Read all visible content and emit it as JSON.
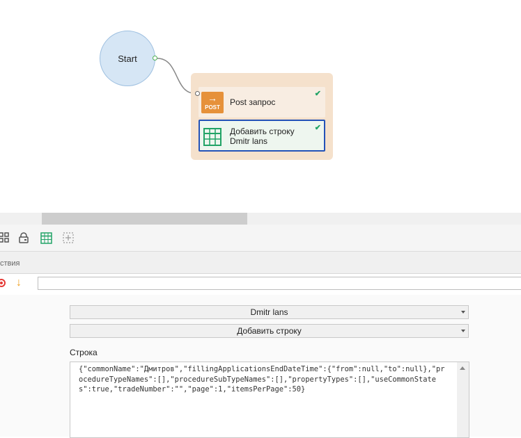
{
  "canvas": {
    "start_node": {
      "label": "Start"
    },
    "group": {
      "actions": [
        {
          "title": "Post запрос",
          "icon_label": "POST",
          "icon": "arrow-right-icon",
          "status": "✔"
        },
        {
          "title_line1": "Добавить строку",
          "title_line2": "Dmitr lans",
          "icon": "table-icon",
          "status": "✔"
        }
      ]
    }
  },
  "toolbar": {
    "icons": [
      "grid-icon",
      "lock-icon",
      "table-icon",
      "add-frame-icon"
    ]
  },
  "section": {
    "title": "ствия"
  },
  "action_row": {
    "icons": [
      "record-icon",
      "arrow-down-icon"
    ],
    "input_value": ""
  },
  "properties": {
    "table_select": "Dmitr lans",
    "operation_select": "Добавить строку",
    "row_label": "Строка",
    "row_value": "{\"commonName\":\"Дмитров\",\"fillingApplicationsEndDateTime\":{\"from\":null,\"to\":null},\"procedureTypeNames\":[],\"procedureSubTypeNames\":[],\"propertyTypes\":[],\"useCommonStates\":true,\"tradeNumber\":\"\",\"page\":1,\"itemsPerPage\":50}"
  },
  "colors": {
    "accent_blue": "#2352b8",
    "post_orange": "#e6913a",
    "success_green": "#21a366",
    "group_bg": "#f5e1cc",
    "start_fill": "#d6e6f5"
  }
}
